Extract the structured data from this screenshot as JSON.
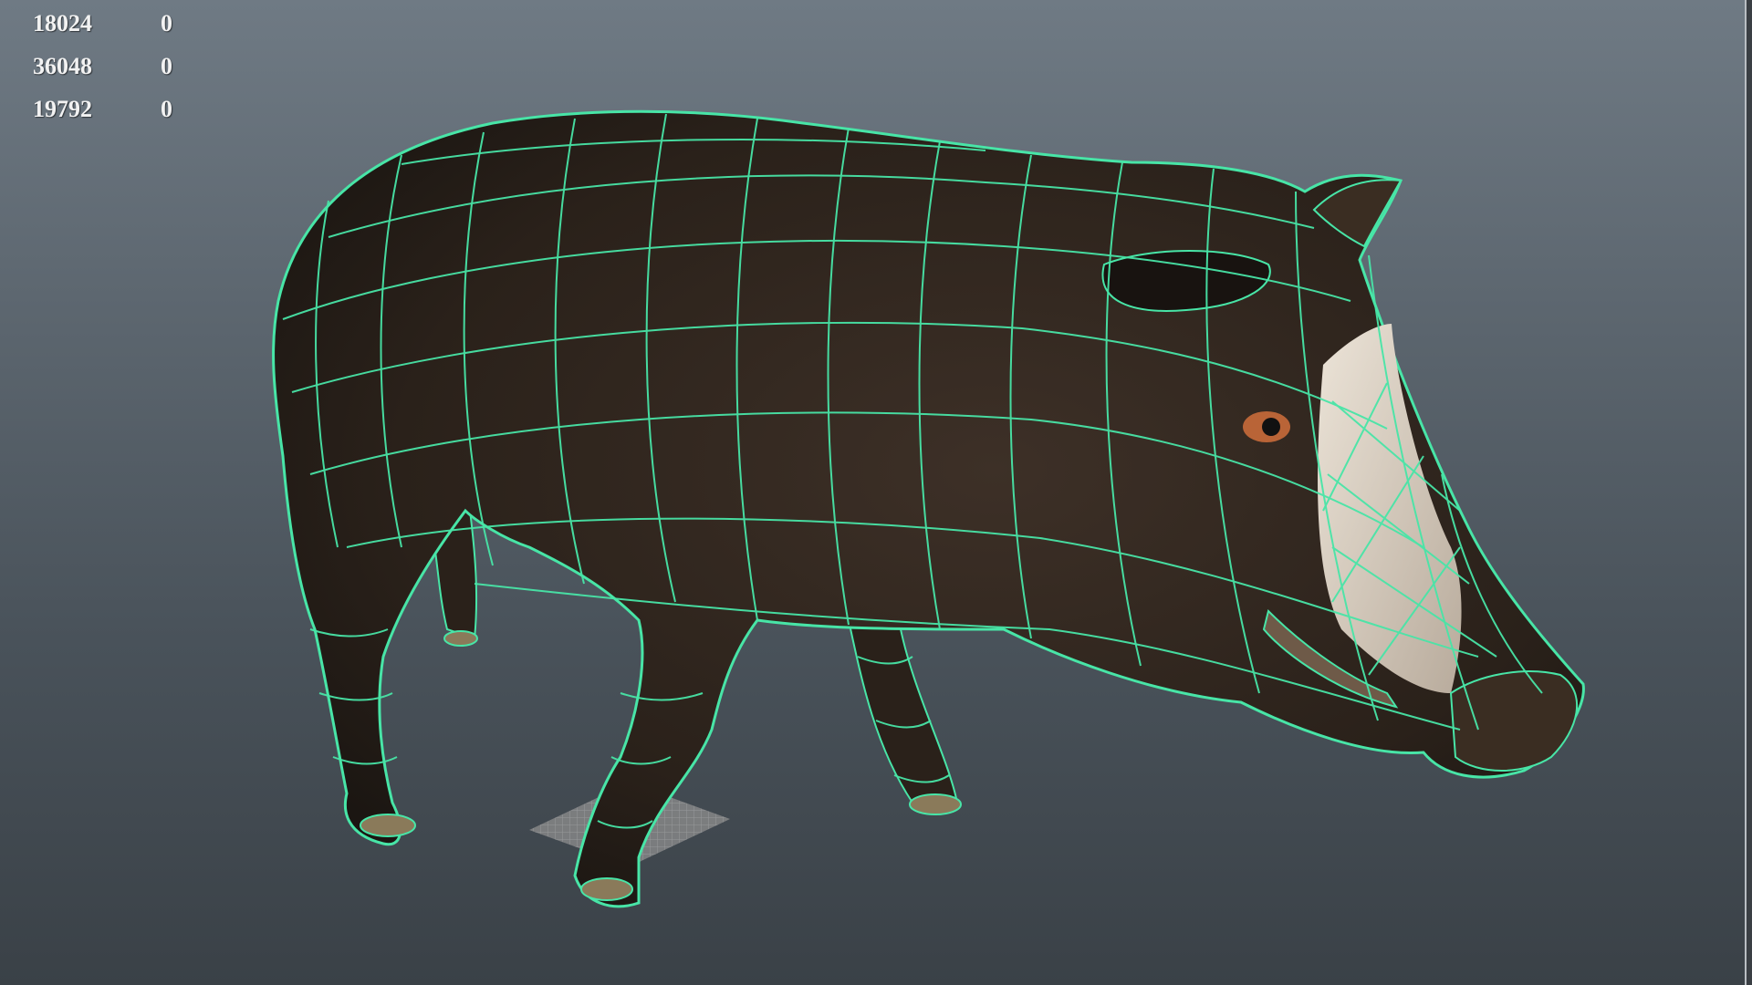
{
  "hud": {
    "rows": [
      {
        "value": "18024",
        "other": "0"
      },
      {
        "value": "36048",
        "other": "0"
      },
      {
        "value": "19792",
        "other": "0"
      }
    ]
  },
  "colors": {
    "background_top": "#6f7a84",
    "background_bottom": "#3a4147",
    "wireframe": "#48e5a7",
    "body": "#33281f",
    "snout": "#d9cfc3",
    "eye": "#c86a3a"
  },
  "scene": {
    "object": "boar-model",
    "object_icon": "boar-mesh-icon"
  }
}
